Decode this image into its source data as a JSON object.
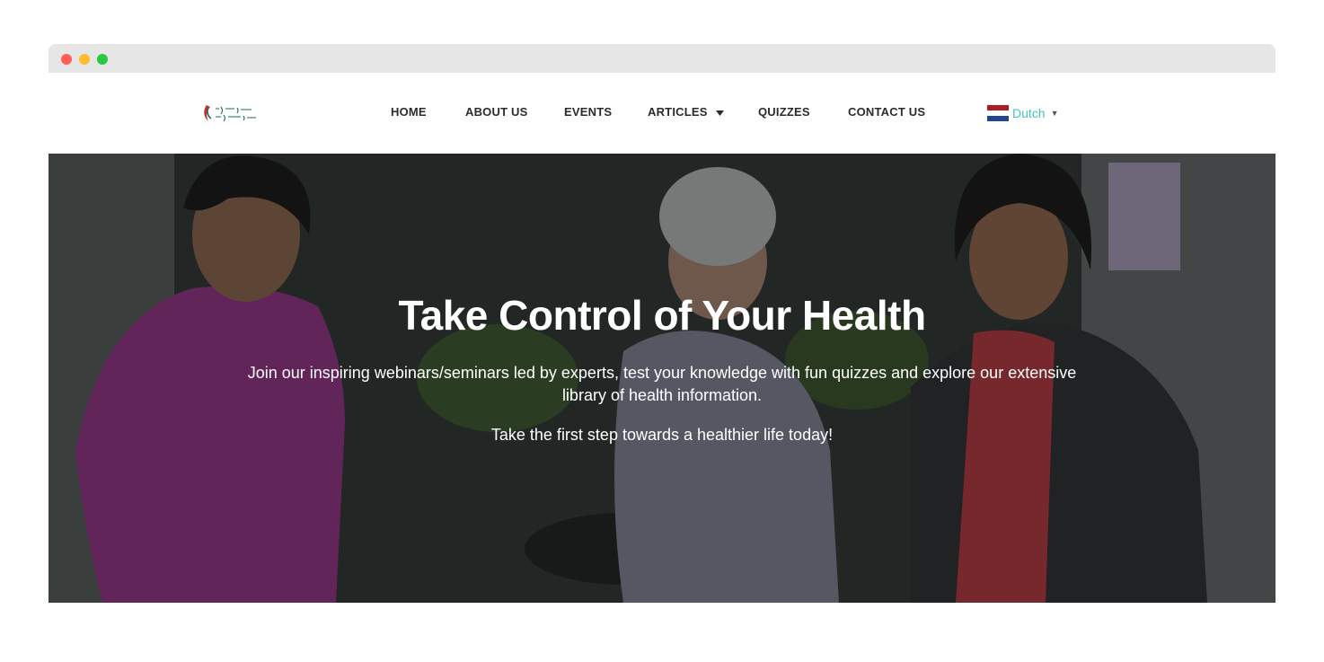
{
  "nav": {
    "items": [
      {
        "label": "HOME"
      },
      {
        "label": "ABOUT US"
      },
      {
        "label": "EVENTS"
      },
      {
        "label": "ARTICLES"
      },
      {
        "label": "QUIZZES"
      },
      {
        "label": "CONTACT US"
      }
    ]
  },
  "language": {
    "selected": "Dutch",
    "flag_colors": [
      "#ae1c28",
      "#ffffff",
      "#21468b"
    ]
  },
  "hero": {
    "title": "Take Control of Your Health",
    "description": "Join our inspiring webinars/seminars led by experts, test your knowledge with fun quizzes and explore our extensive library of health information.",
    "cta": "Take the first step towards a healthier life today!"
  },
  "colors": {
    "accent": "#3ec6b9",
    "nav_text": "#2b2b2b"
  }
}
